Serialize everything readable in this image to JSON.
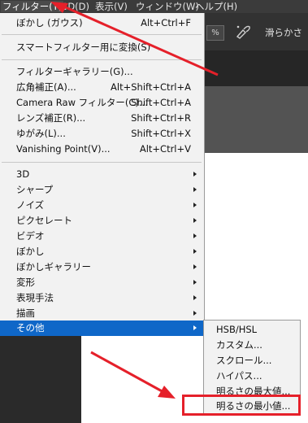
{
  "menubar": {
    "items": [
      {
        "label": "フィルター(T)",
        "active": true
      },
      {
        "label": "3D(D)"
      },
      {
        "label": "表示(V)"
      },
      {
        "label": "ウィンドウ(W)"
      },
      {
        "label": "ヘルプ(H)"
      }
    ]
  },
  "options_bar": {
    "percent_value": "%",
    "tool_icon": "airbrush-icon",
    "smoothing_label": "滑らかさ"
  },
  "filter_menu": {
    "last_filter": {
      "label": "ぼかし (ガウス)",
      "shortcut": "Alt+Ctrl+F"
    },
    "convert_smart": {
      "label": "スマートフィルター用に変換(S)"
    },
    "gallery_items": [
      {
        "label": "フィルターギャラリー(G)...",
        "shortcut": ""
      },
      {
        "label": "広角補正(A)...",
        "shortcut": "Alt+Shift+Ctrl+A"
      },
      {
        "label": "Camera Raw フィルター(C)...",
        "shortcut": "Shift+Ctrl+A"
      },
      {
        "label": "レンズ補正(R)...",
        "shortcut": "Shift+Ctrl+R"
      },
      {
        "label": "ゆがみ(L)...",
        "shortcut": "Shift+Ctrl+X"
      },
      {
        "label": "Vanishing Point(V)...",
        "shortcut": "Alt+Ctrl+V"
      }
    ],
    "submenu_items": [
      {
        "label": "3D"
      },
      {
        "label": "シャープ"
      },
      {
        "label": "ノイズ"
      },
      {
        "label": "ピクセレート"
      },
      {
        "label": "ビデオ"
      },
      {
        "label": "ぼかし"
      },
      {
        "label": "ぼかしギャラリー"
      },
      {
        "label": "変形"
      },
      {
        "label": "表現手法"
      },
      {
        "label": "描画"
      },
      {
        "label": "その他",
        "highlighted": true
      }
    ]
  },
  "other_submenu": {
    "items": [
      {
        "label": "HSB/HSL"
      },
      {
        "label": "カスタム..."
      },
      {
        "label": "スクロール..."
      },
      {
        "label": "ハイパス..."
      },
      {
        "label": "明るさの最大値..."
      },
      {
        "label": "明るさの最小値...",
        "highlighted": true
      }
    ]
  },
  "annotation": {
    "color": "#e5202a"
  }
}
